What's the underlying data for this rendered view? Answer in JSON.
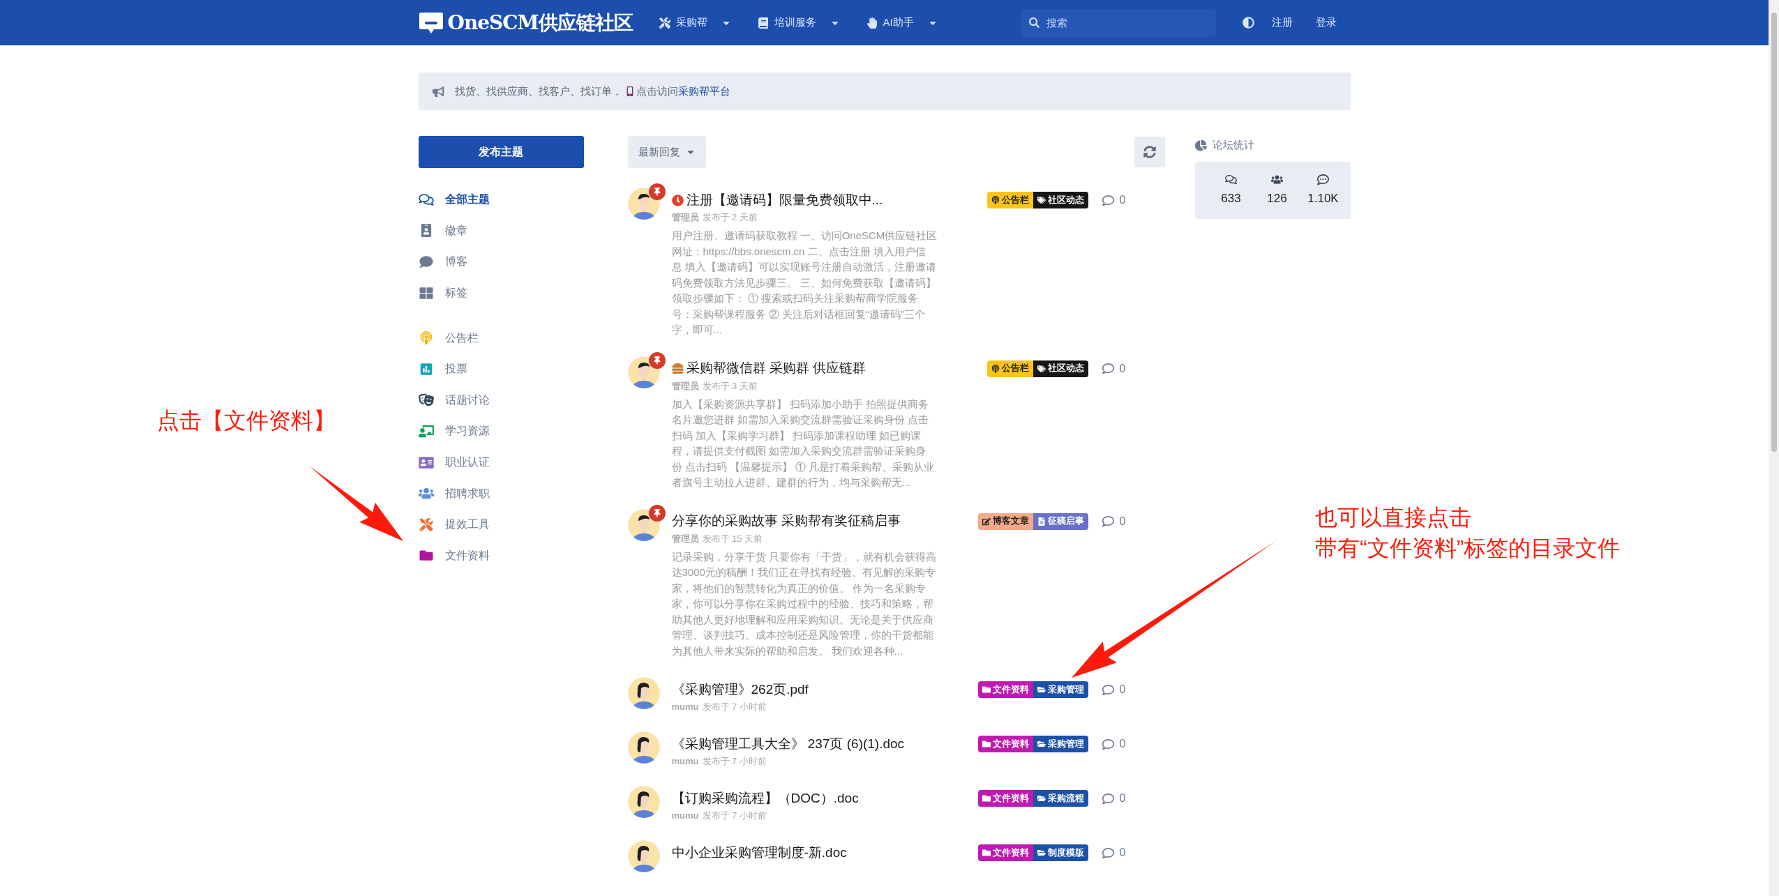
{
  "header": {
    "logo": "OneSCM供应链社区",
    "nav": [
      {
        "label": "采购帮"
      },
      {
        "label": "培训服务"
      },
      {
        "label": "AI助手"
      }
    ],
    "search": {
      "placeholder": "搜索"
    },
    "actions": [
      "注册",
      "登录"
    ]
  },
  "notice": {
    "text": "找货、找供应商、找客户、找订单，",
    "text2": "点击访问",
    "link": "采购帮平台"
  },
  "compose_button": "发布主题",
  "sidebar": {
    "groups": [
      {
        "items": [
          {
            "label": "全部主题",
            "selected": true
          },
          {
            "label": "徽章",
            "selected": false
          },
          {
            "label": "博客",
            "selected": false
          },
          {
            "label": "标签",
            "selected": false
          }
        ]
      },
      {
        "items": [
          {
            "label": "公告栏",
            "selected": false
          },
          {
            "label": "投票",
            "selected": false
          },
          {
            "label": "话题讨论",
            "selected": false
          },
          {
            "label": "学习资源",
            "selected": false
          },
          {
            "label": "职业认证",
            "selected": false
          },
          {
            "label": "招聘求职",
            "selected": false
          },
          {
            "label": "提效工具",
            "selected": false
          },
          {
            "label": "文件资料",
            "selected": false
          }
        ]
      }
    ]
  },
  "sort": "最新回复",
  "posts": [
    {
      "title": "注册【邀请码】限量免费领取中...",
      "pinned": true,
      "author": "管理员",
      "time": "发布于 2 天前",
      "excerpt": "用户注册、邀请码获取教程 一、访问OneSCM供应链社区网址：https://bbs.onescm.cn 二、点击注册 填入用户信息 填入【邀请码】可以实现账号注册自动激活，注册邀请码免费领取方法见步骤三。 三、如何免费获取【邀请码】领取步骤如下： ① 搜索或扫码关注采购帮商学院服务号：采购帮课程服务 ② 关注后对话框回复“邀请码”三个字，即可...",
      "tags": [
        {
          "label": "公告栏",
          "color": "#fcc419"
        },
        {
          "label": "社区动态",
          "color": "#161616"
        }
      ],
      "comments": "0"
    },
    {
      "title": "采购帮微信群 采购群 供应链群",
      "pinned": true,
      "author": "管理员",
      "time": "发布于 3 天前",
      "excerpt": "加入【采购资源共享群】 扫码添加小助手 拍照提供商务名片邀您进群 如需加入采购交流群需验证采购身份 点击扫码 加入【采购学习群】 扫码添加课程助理 如已购课程，请提供支付截图 如需加入采购交流群需验证采购身份 点击扫码 【温馨提示】 ① 凡是打着采购帮、采购从业者旗号主动拉人进群、建群的行为，均与采购帮无...",
      "tags": [
        {
          "label": "公告栏",
          "color": "#fcc419"
        },
        {
          "label": "社区动态",
          "color": "#161616"
        }
      ],
      "comments": "0"
    },
    {
      "title": "分享你的采购故事 采购帮有奖征稿启事",
      "pinned": true,
      "author": "管理员",
      "time": "发布于 15 天前",
      "excerpt": "记录采购，分享干货 只要你有「干货」，就有机会获得高达3000元的稿酬！我们正在寻找有经验、有见解的采购专家，将他们的智慧转化为真正的价值。 作为一名采购专家，你可以分享你在采购过程中的经验、技巧和策略，帮助其他人更好地理解和应用采购知识。无论是关于供应商管理、谈判技巧、成本控制还是风险管理，你的干货都能为其他人带来实际的帮助和启发。 我们欢迎各种...",
      "tags": [
        {
          "label": "博客文章",
          "color": "#f4a98a"
        },
        {
          "label": "征稿启事",
          "color": "#6a6fc8"
        }
      ],
      "comments": "0"
    },
    {
      "title": "《采购管理》262页.pdf",
      "pinned": false,
      "author": "mumu",
      "time": "发布于 7 小时前",
      "tags": [
        {
          "label": "文件资料",
          "color": "#c01bb0"
        },
        {
          "label": "采购管理",
          "color": "#1d50a8"
        }
      ],
      "comments": "0"
    },
    {
      "title": "《采购管理工具大全》 237页 (6)(1).doc",
      "pinned": false,
      "author": "mumu",
      "time": "发布于 7 小时前",
      "tags": [
        {
          "label": "文件资料",
          "color": "#c01bb0"
        },
        {
          "label": "采购管理",
          "color": "#1d50a8"
        }
      ],
      "comments": "0"
    },
    {
      "title": "【订购采购流程】（DOC）.doc",
      "pinned": false,
      "author": "mumu",
      "time": "发布于 7 小时前",
      "tags": [
        {
          "label": "文件资料",
          "color": "#c01bb0"
        },
        {
          "label": "采购流程",
          "color": "#1d50a8"
        }
      ],
      "comments": "0"
    },
    {
      "title": "中小企业采购管理制度-新.doc",
      "pinned": false,
      "tags": [
        {
          "label": "文件资料",
          "color": "#c01bb0"
        },
        {
          "label": "制度模版",
          "color": "#1d50a8"
        }
      ],
      "comments": "0"
    }
  ],
  "stats": {
    "title": "论坛统计",
    "values": [
      "633",
      "126",
      "1.10K"
    ]
  },
  "annotations": [
    {
      "lines": [
        "点击【文件资料】"
      ]
    },
    {
      "lines": [
        "也可以直接点击",
        "带有“文件资料”标签的目录文件"
      ]
    }
  ]
}
